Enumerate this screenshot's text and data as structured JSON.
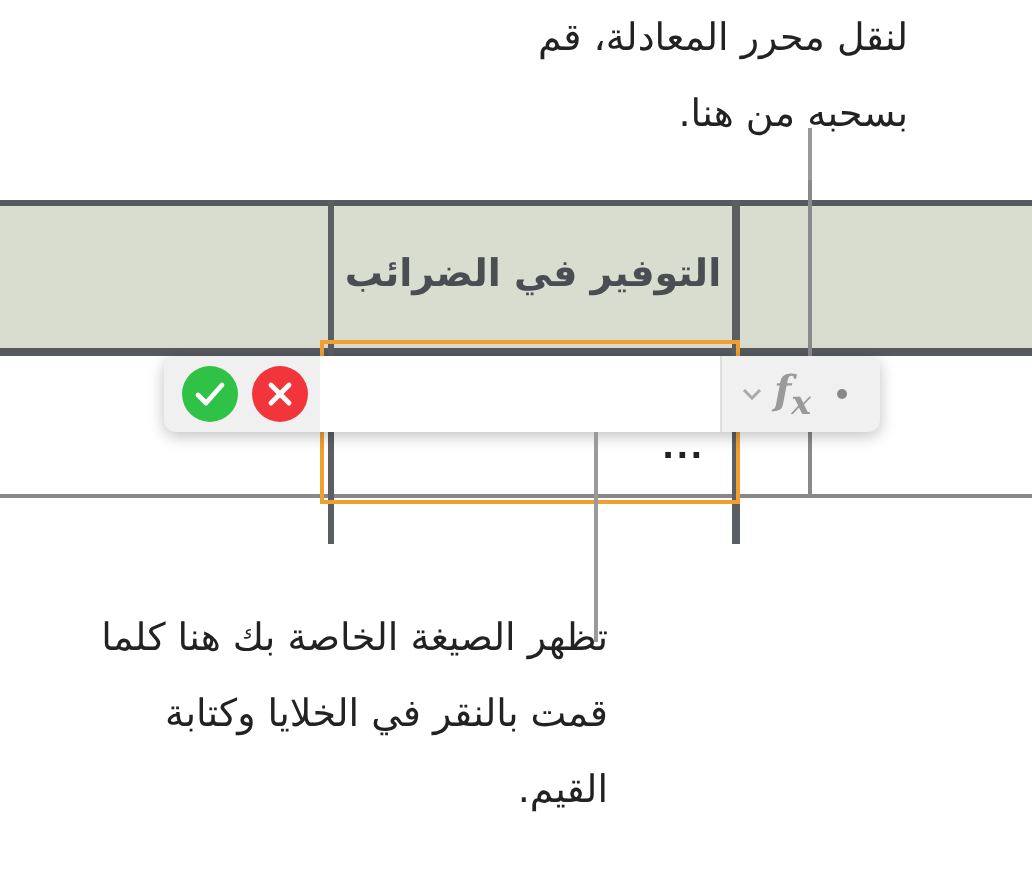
{
  "callouts": [
    {
      "text": "لنقل محرر المعادلة، قم بسحبه من هنا."
    },
    {
      "text": "تظهر الصيغة الخاصة بك هنا كلما قمت بالنقر في الخلايا وكتابة القيم."
    }
  ],
  "table": {
    "header": "التوفير في الضرائب",
    "cell_text": "..."
  },
  "formula_editor": {
    "function_label": "f$_{x}$"
  }
}
